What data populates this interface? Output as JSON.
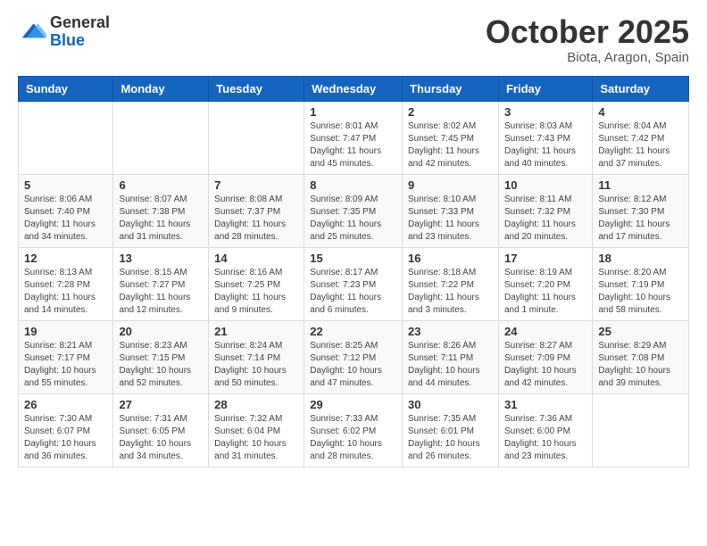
{
  "header": {
    "logo_general": "General",
    "logo_blue": "Blue",
    "month_title": "October 2025",
    "location": "Biota, Aragon, Spain"
  },
  "days_of_week": [
    "Sunday",
    "Monday",
    "Tuesday",
    "Wednesday",
    "Thursday",
    "Friday",
    "Saturday"
  ],
  "weeks": [
    [
      {
        "day": "",
        "info": ""
      },
      {
        "day": "",
        "info": ""
      },
      {
        "day": "",
        "info": ""
      },
      {
        "day": "1",
        "info": "Sunrise: 8:01 AM\nSunset: 7:47 PM\nDaylight: 11 hours\nand 45 minutes."
      },
      {
        "day": "2",
        "info": "Sunrise: 8:02 AM\nSunset: 7:45 PM\nDaylight: 11 hours\nand 42 minutes."
      },
      {
        "day": "3",
        "info": "Sunrise: 8:03 AM\nSunset: 7:43 PM\nDaylight: 11 hours\nand 40 minutes."
      },
      {
        "day": "4",
        "info": "Sunrise: 8:04 AM\nSunset: 7:42 PM\nDaylight: 11 hours\nand 37 minutes."
      }
    ],
    [
      {
        "day": "5",
        "info": "Sunrise: 8:06 AM\nSunset: 7:40 PM\nDaylight: 11 hours\nand 34 minutes."
      },
      {
        "day": "6",
        "info": "Sunrise: 8:07 AM\nSunset: 7:38 PM\nDaylight: 11 hours\nand 31 minutes."
      },
      {
        "day": "7",
        "info": "Sunrise: 8:08 AM\nSunset: 7:37 PM\nDaylight: 11 hours\nand 28 minutes."
      },
      {
        "day": "8",
        "info": "Sunrise: 8:09 AM\nSunset: 7:35 PM\nDaylight: 11 hours\nand 25 minutes."
      },
      {
        "day": "9",
        "info": "Sunrise: 8:10 AM\nSunset: 7:33 PM\nDaylight: 11 hours\nand 23 minutes."
      },
      {
        "day": "10",
        "info": "Sunrise: 8:11 AM\nSunset: 7:32 PM\nDaylight: 11 hours\nand 20 minutes."
      },
      {
        "day": "11",
        "info": "Sunrise: 8:12 AM\nSunset: 7:30 PM\nDaylight: 11 hours\nand 17 minutes."
      }
    ],
    [
      {
        "day": "12",
        "info": "Sunrise: 8:13 AM\nSunset: 7:28 PM\nDaylight: 11 hours\nand 14 minutes."
      },
      {
        "day": "13",
        "info": "Sunrise: 8:15 AM\nSunset: 7:27 PM\nDaylight: 11 hours\nand 12 minutes."
      },
      {
        "day": "14",
        "info": "Sunrise: 8:16 AM\nSunset: 7:25 PM\nDaylight: 11 hours\nand 9 minutes."
      },
      {
        "day": "15",
        "info": "Sunrise: 8:17 AM\nSunset: 7:23 PM\nDaylight: 11 hours\nand 6 minutes."
      },
      {
        "day": "16",
        "info": "Sunrise: 8:18 AM\nSunset: 7:22 PM\nDaylight: 11 hours\nand 3 minutes."
      },
      {
        "day": "17",
        "info": "Sunrise: 8:19 AM\nSunset: 7:20 PM\nDaylight: 11 hours\nand 1 minute."
      },
      {
        "day": "18",
        "info": "Sunrise: 8:20 AM\nSunset: 7:19 PM\nDaylight: 10 hours\nand 58 minutes."
      }
    ],
    [
      {
        "day": "19",
        "info": "Sunrise: 8:21 AM\nSunset: 7:17 PM\nDaylight: 10 hours\nand 55 minutes."
      },
      {
        "day": "20",
        "info": "Sunrise: 8:23 AM\nSunset: 7:15 PM\nDaylight: 10 hours\nand 52 minutes."
      },
      {
        "day": "21",
        "info": "Sunrise: 8:24 AM\nSunset: 7:14 PM\nDaylight: 10 hours\nand 50 minutes."
      },
      {
        "day": "22",
        "info": "Sunrise: 8:25 AM\nSunset: 7:12 PM\nDaylight: 10 hours\nand 47 minutes."
      },
      {
        "day": "23",
        "info": "Sunrise: 8:26 AM\nSunset: 7:11 PM\nDaylight: 10 hours\nand 44 minutes."
      },
      {
        "day": "24",
        "info": "Sunrise: 8:27 AM\nSunset: 7:09 PM\nDaylight: 10 hours\nand 42 minutes."
      },
      {
        "day": "25",
        "info": "Sunrise: 8:29 AM\nSunset: 7:08 PM\nDaylight: 10 hours\nand 39 minutes."
      }
    ],
    [
      {
        "day": "26",
        "info": "Sunrise: 7:30 AM\nSunset: 6:07 PM\nDaylight: 10 hours\nand 36 minutes."
      },
      {
        "day": "27",
        "info": "Sunrise: 7:31 AM\nSunset: 6:05 PM\nDaylight: 10 hours\nand 34 minutes."
      },
      {
        "day": "28",
        "info": "Sunrise: 7:32 AM\nSunset: 6:04 PM\nDaylight: 10 hours\nand 31 minutes."
      },
      {
        "day": "29",
        "info": "Sunrise: 7:33 AM\nSunset: 6:02 PM\nDaylight: 10 hours\nand 28 minutes."
      },
      {
        "day": "30",
        "info": "Sunrise: 7:35 AM\nSunset: 6:01 PM\nDaylight: 10 hours\nand 26 minutes."
      },
      {
        "day": "31",
        "info": "Sunrise: 7:36 AM\nSunset: 6:00 PM\nDaylight: 10 hours\nand 23 minutes."
      },
      {
        "day": "",
        "info": ""
      }
    ]
  ]
}
